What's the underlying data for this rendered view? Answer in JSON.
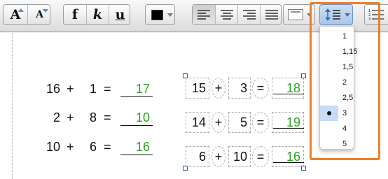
{
  "toolbar": {
    "font_grow_label": "A",
    "font_shrink_label": "A",
    "bold_label": "f",
    "italic_label": "k",
    "underline_label": "u",
    "text_color": "#000000",
    "line_spacing_icon_text": "1\n2\n3"
  },
  "equations": [
    {
      "a": "16",
      "op": "+",
      "b": "1",
      "eq": "=",
      "answer": "17"
    },
    {
      "a": "2",
      "op": "+",
      "b": "8",
      "eq": "=",
      "answer": "10"
    },
    {
      "a": "10",
      "op": "+",
      "b": "6",
      "eq": "=",
      "answer": "16"
    }
  ],
  "boxed_equations": [
    {
      "a": "15",
      "op": "+",
      "b": "3",
      "eq": "=",
      "answer": "18"
    },
    {
      "a": "14",
      "op": "+",
      "b": "5",
      "eq": "=",
      "answer": "19"
    },
    {
      "a": "6",
      "op": "+",
      "b": "10",
      "eq": "=",
      "answer": "16"
    }
  ],
  "line_spacing_menu": {
    "items": [
      "1",
      "1,15",
      "1,5",
      "2",
      "2,5",
      "3",
      "4",
      "5"
    ],
    "selected": "3"
  },
  "colors": {
    "answer": "#2aa424",
    "highlight": "#f07e26",
    "selected_item": "#c6dcf7",
    "accent": "#4a8ed6"
  }
}
